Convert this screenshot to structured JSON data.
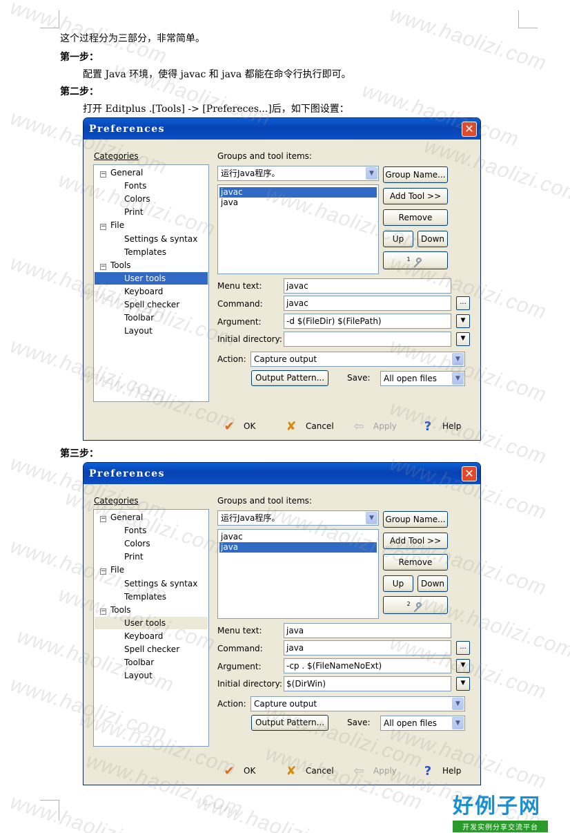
{
  "doc": {
    "intro": "这个过程分为三部分，非常简单。",
    "step1_title": "第一步：",
    "step1_text": "配置 Java 环境，使得 javac 和 java 都能在命令行执行即可。",
    "step2_title": "第二步：",
    "step2_text": "打开 Editplus .[Tools] -> [Prefereces...]后，如下图设置：",
    "step3_title": "第三步："
  },
  "watermark": "www.haolizi.com",
  "logo": {
    "main": "好例子网",
    "sub": "开发实例分享交流平台"
  },
  "dialogs": [
    {
      "title": "Preferences",
      "close": "✕",
      "categories_label": "Categories",
      "tree": {
        "general": "General",
        "fonts": "Fonts",
        "colors": "Colors",
        "print": "Print",
        "file": "File",
        "settings": "Settings & syntax",
        "templates": "Templates",
        "tools": "Tools",
        "user_tools": "User tools",
        "keyboard": "Keyboard",
        "spell": "Spell checker",
        "toolbar": "Toolbar",
        "layout": "Layout"
      },
      "groups_label": "Groups and tool items:",
      "group_value": "运行Java程序。",
      "list": [
        "javac",
        "java"
      ],
      "buttons": {
        "group_name": "Group Name...",
        "add_tool": "Add Tool >>",
        "remove": "Remove",
        "up": "Up",
        "down": "Down",
        "tool_num": "1"
      },
      "menu_text_label": "Menu text:",
      "command_label": "Command:",
      "argument_label": "Argument:",
      "initdir_label": "Initial directory:",
      "menu_text": "javac",
      "command": "javac",
      "argument": "-d $(FileDir) $(FilePath)",
      "initdir": "",
      "browse": "...",
      "dropdown": "▼",
      "action_label": "Action:",
      "action": "Capture output",
      "output_pattern": "Output Pattern...",
      "save_label": "Save:",
      "save": "All open files",
      "ok": "OK",
      "cancel": "Cancel",
      "apply": "Apply",
      "help": "Help"
    },
    {
      "title": "Preferences",
      "close": "✕",
      "categories_label": "Categories",
      "tree": {
        "general": "General",
        "fonts": "Fonts",
        "colors": "Colors",
        "print": "Print",
        "file": "File",
        "settings": "Settings & syntax",
        "templates": "Templates",
        "tools": "Tools",
        "user_tools": "User tools",
        "keyboard": "Keyboard",
        "spell": "Spell checker",
        "toolbar": "Toolbar",
        "layout": "Layout"
      },
      "groups_label": "Groups and tool items:",
      "group_value": "运行Java程序。",
      "list": [
        "javac",
        "java"
      ],
      "buttons": {
        "group_name": "Group Name...",
        "add_tool": "Add Tool >>",
        "remove": "Remove",
        "up": "Up",
        "down": "Down",
        "tool_num": "2"
      },
      "menu_text_label": "Menu text:",
      "command_label": "Command:",
      "argument_label": "Argument:",
      "initdir_label": "Initial directory:",
      "menu_text": "java",
      "command": "java",
      "argument": "-cp . $(FileNameNoExt)",
      "initdir": "$(DirWin)",
      "browse": "...",
      "dropdown": "▼",
      "action_label": "Action:",
      "action": "Capture output",
      "output_pattern": "Output Pattern...",
      "save_label": "Save:",
      "save": "All open files",
      "ok": "OK",
      "cancel": "Cancel",
      "apply": "Apply",
      "help": "Help"
    }
  ]
}
